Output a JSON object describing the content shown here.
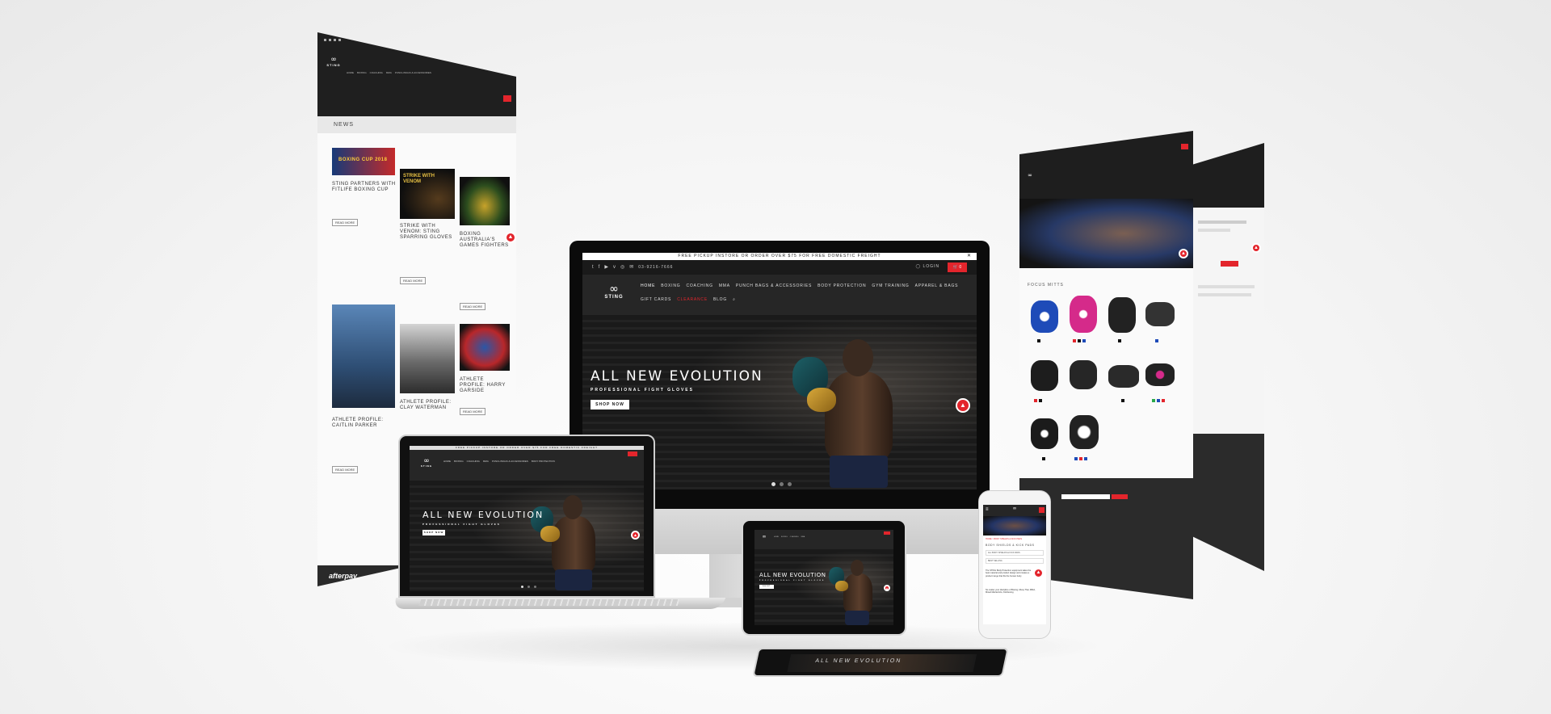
{
  "brand": {
    "logo_text": "STING",
    "accent_color": "#e3252c",
    "dark_color": "#1c1c1c"
  },
  "site": {
    "topbar_text": "FREE PICKUP INSTORE OR ORDER OVER $75 FOR FREE DOMESTIC FREIGHT",
    "phone": "03-9216-7666",
    "login_label": "LOGIN",
    "cart_count": "0",
    "nav_items": [
      "HOME",
      "BOXING",
      "COACHING",
      "MMA",
      "PUNCH BAGS & ACCESSORIES",
      "BODY PROTECTION",
      "GYM TRAINING",
      "APPAREL & BAGS"
    ],
    "nav_items_row2": [
      "GIFT CARDS",
      "CLEARANCE",
      "BLOG"
    ],
    "social_icons": [
      "twitter-icon",
      "facebook-icon",
      "youtube-icon",
      "vimeo-icon",
      "instagram-icon",
      "email-icon"
    ]
  },
  "hero": {
    "title": "ALL NEW EVOLUTION",
    "subtitle": "PROFESSIONAL FIGHT GLOVES",
    "button": "SHOP NOW"
  },
  "news": {
    "heading": "NEWS",
    "banner_text": "BOXING CUP 2018",
    "strike_text": "STRIKE WITH VENOM",
    "read_more": "READ MORE",
    "posts": [
      {
        "title": "STING PARTNERS WITH FITLIFE BOXING CUP"
      },
      {
        "title": "STRIKE WITH VENOM: STING SPARRING GLOVES"
      },
      {
        "title": "BOXING AUSTRALIA'S GAMES FIGHTERS"
      },
      {
        "title": "ATHLETE PROFILE: CAITLIN PARKER"
      },
      {
        "title": "ATHLETE PROFILE: CLAY WATERMAN"
      },
      {
        "title": "ATHLETE PROFILE: HARRY GARSIDE"
      }
    ],
    "footer_brand": "afterpay"
  },
  "products": {
    "heading": "FOCUS MITTS"
  },
  "phone_page": {
    "breadcrumb": "HOME > BODY SHIELDS & KICK PADS",
    "section_title": "BODY SHIELDS & KICK PADS",
    "filter_label": "ALL BODY SHIELDS & KICK PADS",
    "sort_label": "BEST SELLING",
    "para1": "The STING Body Protection equipment takes the best material and product design and creates a product range that fits the human body.",
    "para2": "No matter your discipline of Boxing, Muay Thai, MMA, Mixed Martial Arts, Kickboxing"
  }
}
